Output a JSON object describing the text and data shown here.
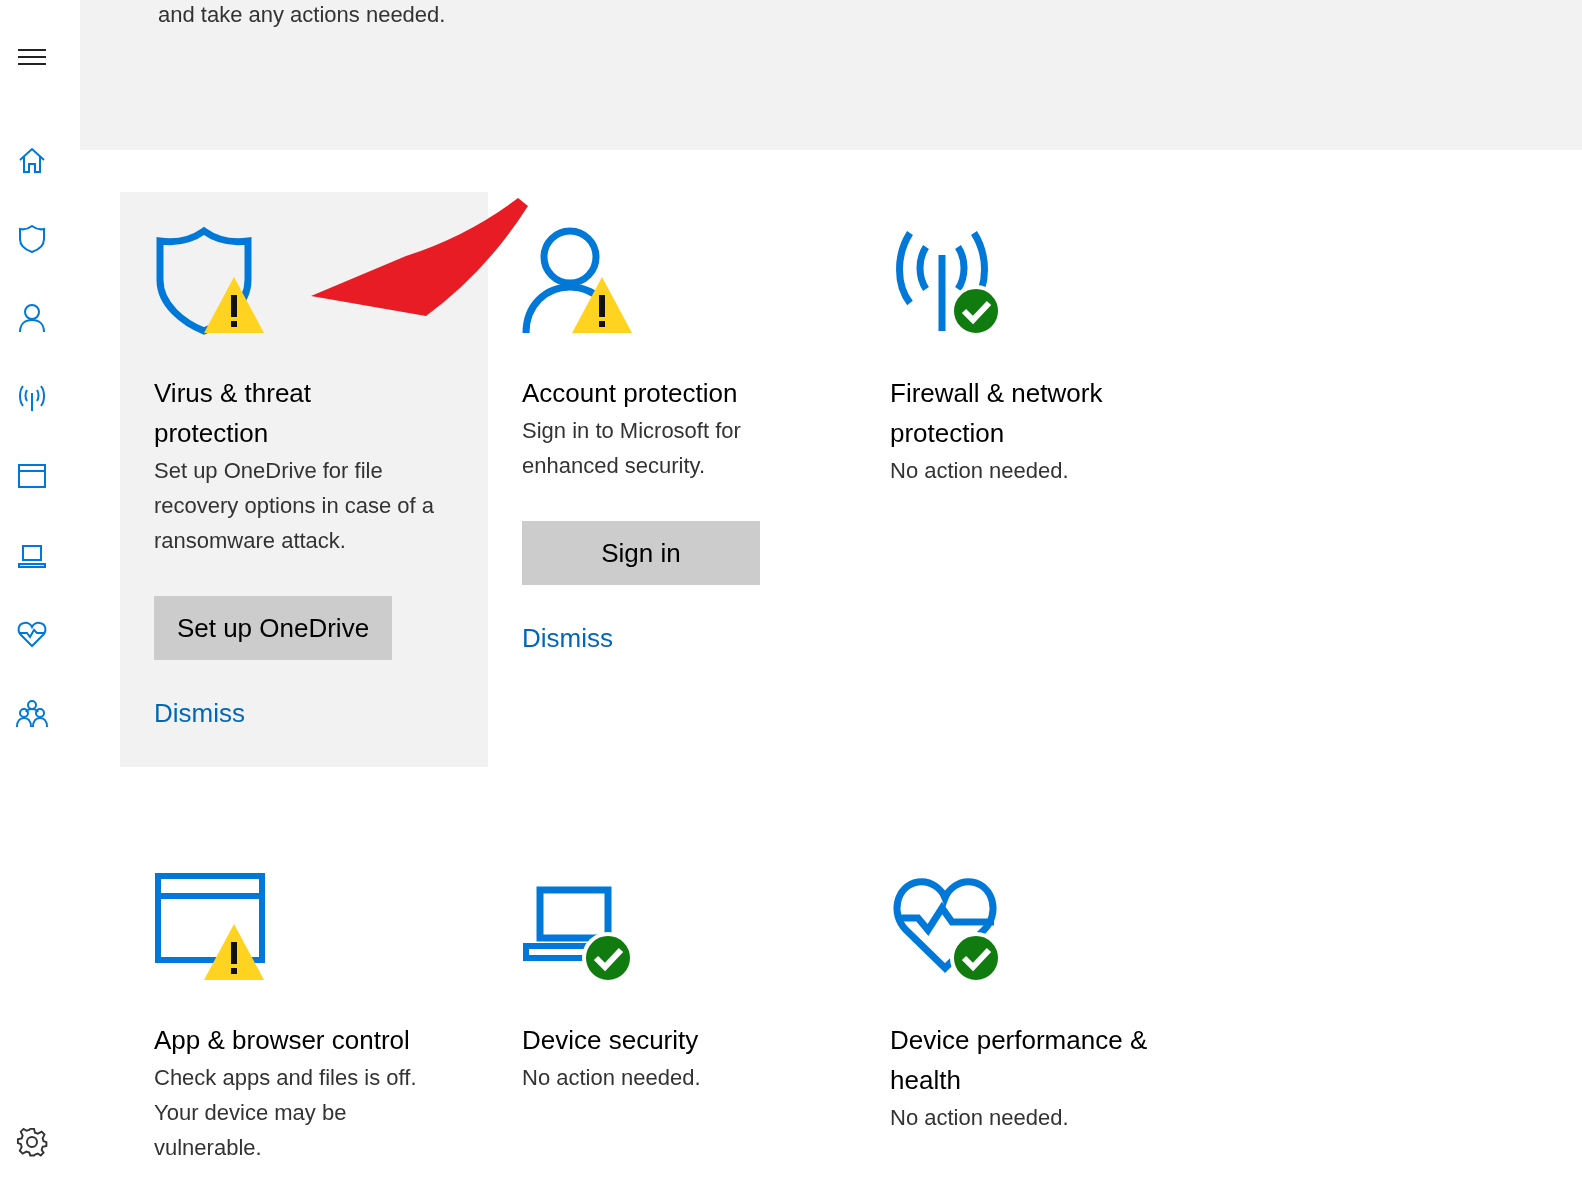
{
  "sidebar": {
    "items": [
      {
        "kind": "menu"
      },
      {
        "kind": "home"
      },
      {
        "kind": "shield"
      },
      {
        "kind": "person"
      },
      {
        "kind": "antenna"
      },
      {
        "kind": "window"
      },
      {
        "kind": "laptop"
      },
      {
        "kind": "heart"
      },
      {
        "kind": "family"
      }
    ],
    "footer": {
      "kind": "gear"
    }
  },
  "banner": {
    "text": "and take any actions needed."
  },
  "cards": [
    {
      "kind": "shield",
      "warning": true,
      "highlighted": true,
      "title": "Virus & threat protection",
      "description": "Set up OneDrive for file recovery options in case of a ransomware attack.",
      "button": "Set up OneDrive",
      "link": "Dismiss"
    },
    {
      "kind": "person",
      "warning": true,
      "highlighted": false,
      "title": "Account protection",
      "description": "Sign in to Microsoft for enhanced security.",
      "button": "Sign in",
      "link": "Dismiss"
    },
    {
      "kind": "antenna",
      "warning": false,
      "highlighted": false,
      "title": "Firewall & network protection",
      "description": "No action needed."
    },
    {
      "kind": "window",
      "warning": true,
      "highlighted": false,
      "title": "App & browser control",
      "description": "Check apps and files is off. Your device may be vulnerable."
    },
    {
      "kind": "laptop",
      "warning": false,
      "highlighted": false,
      "title": "Device security",
      "description": "No action needed."
    },
    {
      "kind": "heart",
      "warning": false,
      "highlighted": false,
      "title": "Device performance & health",
      "description": "No action needed."
    }
  ],
  "annotation": {
    "kind": "arrow"
  }
}
